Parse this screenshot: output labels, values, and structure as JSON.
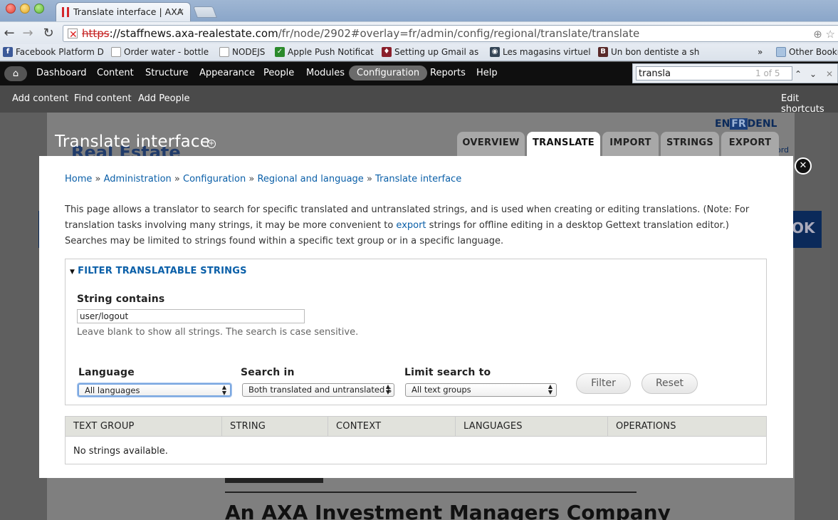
{
  "browser": {
    "tab_title": "Translate interface | AXA",
    "tab_close": "×",
    "url_scheme": "https",
    "url_host": "://staffnews.axa-realestate.com",
    "url_path": "/fr/node/2902#overlay=fr/admin/config/regional/translate/translate",
    "bookmarks": [
      {
        "label": "Facebook Platform D",
        "icon": "facebook-icon",
        "color": "#3b5998"
      },
      {
        "label": "Order water - bottle",
        "icon": "page-icon",
        "color": "#777777"
      },
      {
        "label": "NODEJS",
        "icon": "page-icon",
        "color": "#777777"
      },
      {
        "label": "Apple Push Notificat",
        "icon": "bookmark-icon",
        "color": "#2b8a2b"
      },
      {
        "label": "Setting up Gmail as",
        "icon": "bookmark-icon",
        "color": "#8a1f2b"
      },
      {
        "label": "Les magasins virtuel",
        "icon": "bookmark-icon",
        "color": "#334455"
      },
      {
        "label": "Un bon dentiste a sh",
        "icon": "bookmark-icon",
        "color": "#5a2a2a"
      }
    ],
    "bookmarks_more": "»",
    "other_bookmarks": "Other Bookm"
  },
  "find": {
    "query": "transla",
    "count": "1 of 5",
    "prev": "⌃",
    "next": "⌄",
    "close": "✕"
  },
  "admin_menu": {
    "items": [
      "Dashboard",
      "Content",
      "Structure",
      "Appearance",
      "People",
      "Modules",
      "Configuration",
      "Reports",
      "Help"
    ],
    "active": "Configuration"
  },
  "shortcuts": {
    "items": [
      "Add content",
      "Find content",
      "Add People"
    ],
    "edit": "Edit shortcuts"
  },
  "underlying": {
    "lang_en": "EN",
    "lang_fr": "FR",
    "lang_de": "DE",
    "lang_nl": "NL",
    "logo": "Real Estate",
    "word": "ord",
    "ok": "OK",
    "tagline": "An AXA Investment Managers Company"
  },
  "overlay": {
    "title": "Translate interface",
    "tabs": [
      "OVERVIEW",
      "TRANSLATE",
      "IMPORT",
      "STRINGS",
      "EXPORT"
    ],
    "active_tab": "TRANSLATE",
    "close": "✕",
    "breadcrumb": [
      "Home",
      "Administration",
      "Configuration",
      "Regional and language",
      "Translate interface"
    ],
    "breadcrumb_sep": "»",
    "intro_before": "This page allows a translator to search for specific translated and untranslated strings, and is used when creating or editing translations. (Note: For translation tasks involving many strings, it may be more convenient to ",
    "intro_link": "export",
    "intro_after": " strings for offline editing in a desktop Gettext translation editor.) Searches may be limited to strings found within a specific text group or in a specific language.",
    "filter": {
      "legend": "FILTER TRANSLATABLE STRINGS",
      "string_label": "String contains",
      "string_value": "user/logout",
      "string_hint": "Leave blank to show all strings. The search is case sensitive.",
      "language_label": "Language",
      "language_value": "All languages",
      "search_in_label": "Search in",
      "search_in_value": "Both translated and untranslated s",
      "limit_label": "Limit search to",
      "limit_value": "All text groups",
      "filter_button": "Filter",
      "reset_button": "Reset"
    },
    "table": {
      "columns": [
        "TEXT GROUP",
        "STRING",
        "CONTEXT",
        "LANGUAGES",
        "OPERATIONS"
      ],
      "empty": "No strings available."
    }
  }
}
